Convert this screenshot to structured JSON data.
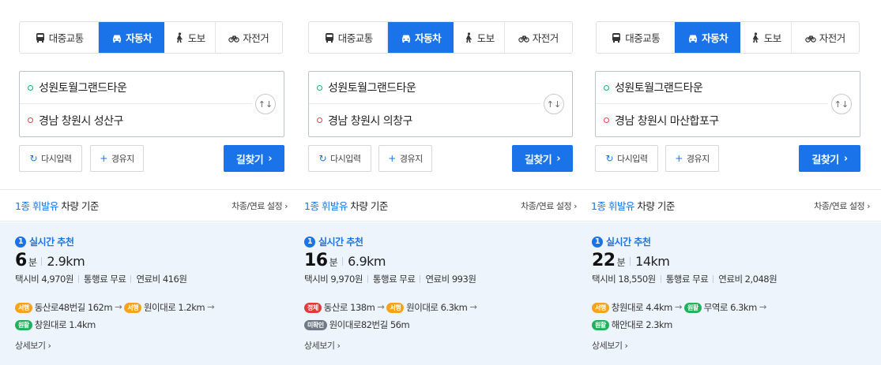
{
  "tabs": {
    "transit": "대중교통",
    "car": "자동차",
    "walk": "도보",
    "bike": "자전거"
  },
  "common": {
    "reset_label": "다시입력",
    "waypoint_label": "경유지",
    "search_label": "길찾기",
    "fuel_prefix": "1종 휘발유",
    "fuel_suffix": "차량 기준",
    "fuel_settings": "차종/연료 설정",
    "rec_number": "1",
    "rec_label": "실시간 추천",
    "time_unit": "분",
    "detail_label": "상세보기"
  },
  "colors": {
    "accent": "#1a73e8",
    "badge_seomyeong": "#f7a21b",
    "badge_wonhwal": "#1fb25a",
    "badge_jeongche": "#e23939",
    "badge_mihwagin": "#6f7a86",
    "result_bg": "#eef4fb"
  },
  "panels": [
    {
      "origin": "성원토월그랜드타운",
      "destination": "경남 창원시 성산구",
      "time": "6",
      "distance": "2.9km",
      "taxi": "택시비 4,970원",
      "toll": "통행료 무료",
      "fuel": "연료비 416원",
      "steps": [
        {
          "badge": "서행",
          "text": "동산로48번길 162m"
        },
        {
          "badge": "서행",
          "text": "원이대로 1.2km"
        },
        {
          "badge": "원활",
          "text": "창원대로 1.4km"
        }
      ]
    },
    {
      "origin": "성원토월그랜드타운",
      "destination": "경남 창원시 의창구",
      "time": "16",
      "distance": "6.9km",
      "taxi": "택시비 9,970원",
      "toll": "통행료 무료",
      "fuel": "연료비 993원",
      "steps": [
        {
          "badge": "정체",
          "text": "동산로 138m"
        },
        {
          "badge": "서행",
          "text": "원이대로 6.3km"
        },
        {
          "badge": "미확인",
          "text": "원이대로82번길 56m"
        }
      ]
    },
    {
      "origin": "성원토월그랜드타운",
      "destination": "경남 창원시 마산합포구",
      "time": "22",
      "distance": "14km",
      "taxi": "택시비 18,550원",
      "toll": "통행료 무료",
      "fuel": "연료비 2,048원",
      "steps": [
        {
          "badge": "서행",
          "text": "창원대로 4.4km"
        },
        {
          "badge": "원활",
          "text": "무역로 6.3km"
        },
        {
          "badge": "원활",
          "text": "해안대로 2.3km"
        }
      ]
    }
  ]
}
